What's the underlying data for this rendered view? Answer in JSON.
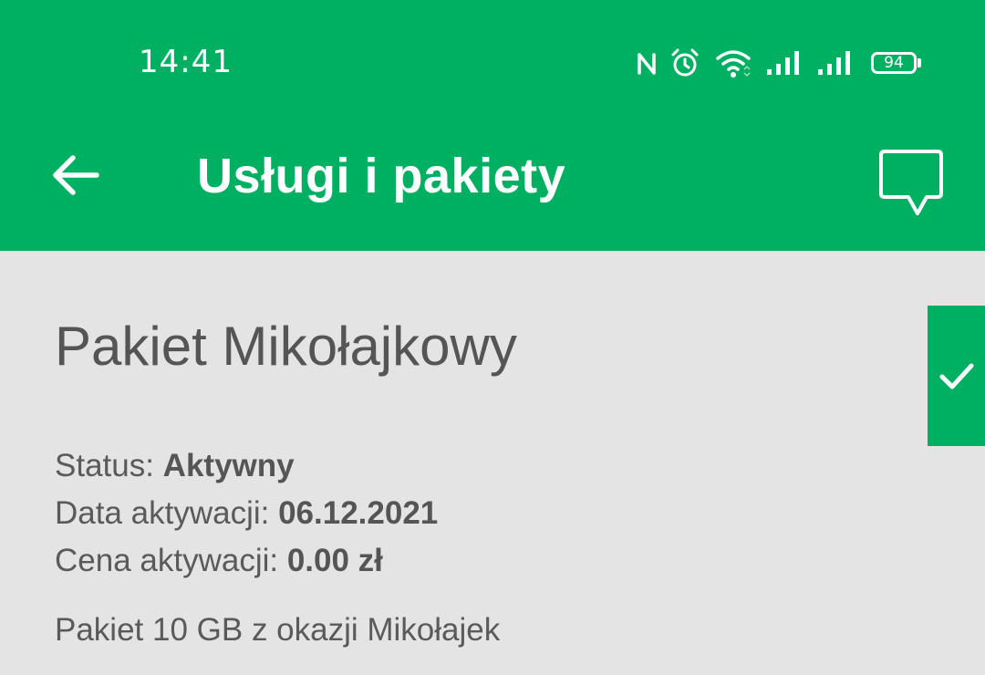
{
  "status_bar": {
    "time": "14:41",
    "battery_level": "94",
    "icons": [
      "nfc-icon",
      "alarm-icon",
      "wifi-icon",
      "signal-icon",
      "signal-icon",
      "battery-icon"
    ]
  },
  "toolbar": {
    "title": "Usługi i pakiety",
    "back_icon": "arrow-left-icon",
    "chat_icon": "chat-bubble-icon"
  },
  "package": {
    "name": "Pakiet Mikołajkowy",
    "status_label": "Status: ",
    "status_value": "Aktywny",
    "activation_date_label": "Data aktywacji: ",
    "activation_date_value": "06.12.2021",
    "activation_price_label": "Cena aktywacji: ",
    "activation_price_value": "0.00 zł",
    "description": "Pakiet 10 GB z okazji Mikołajek",
    "active_indicator_icon": "checkmark-icon"
  },
  "colors": {
    "brand_green": "#00b062",
    "background": "#e4e4e4",
    "text": "#555555"
  }
}
